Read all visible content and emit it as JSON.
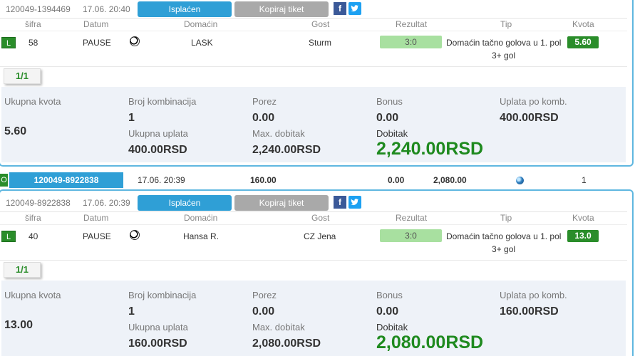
{
  "tickets": [
    {
      "code": "120049-1394469",
      "time": "17.06. 20:40",
      "paid_label": "Isplaćen",
      "copy_label": "Kopiraj tiket",
      "fb_label": "f",
      "columns": {
        "sifra": "šifra",
        "datum": "Datum",
        "domacin": "Domaćin",
        "gost": "Gost",
        "rezultat": "Rezultat",
        "tip": "Tip",
        "kvota": "Kvota"
      },
      "row": {
        "status": "L",
        "sifra": "58",
        "datum": "PAUSE",
        "domacin": "LASK",
        "gost": "Sturm",
        "rezultat": "3:0",
        "tip_line1": "Domaćin tačno golova u 1. pol",
        "tip_line2": "3+ gol",
        "kvota": "5.60"
      },
      "counter": "1/1",
      "summary": {
        "ukupna_kvota_label": "Ukupna kvota",
        "ukupna_kvota": "5.60",
        "broj_komb_label": "Broj kombinacija",
        "broj_komb": "1",
        "ukupna_uplata_label": "Ukupna uplata",
        "ukupna_uplata": "400.00RSD",
        "porez_label": "Porez",
        "porez": "0.00",
        "max_dobitak_label": "Max. dobitak",
        "max_dobitak": "2,240.00RSD",
        "bonus_label": "Bonus",
        "bonus": "0.00",
        "dobitak_label": "Dobitak",
        "dobitak": "2,240.00RSD",
        "uplata_po_komb_label": "Uplata po komb.",
        "uplata_po_komb": "400.00RSD"
      }
    },
    {
      "code": "120049-8922838",
      "time": "17.06. 20:39",
      "paid_label": "Isplaćen",
      "copy_label": "Kopiraj tiket",
      "fb_label": "f",
      "columns": {
        "sifra": "šifra",
        "datum": "Datum",
        "domacin": "Domaćin",
        "gost": "Gost",
        "rezultat": "Rezultat",
        "tip": "Tip",
        "kvota": "Kvota"
      },
      "row": {
        "status": "L",
        "sifra": "40",
        "datum": "PAUSE",
        "domacin": "Hansa R.",
        "gost": "CZ Jena",
        "rezultat": "3:0",
        "tip_line1": "Domaćin tačno golova u 1. pol",
        "tip_line2": "3+ gol",
        "kvota": "13.0"
      },
      "counter": "1/1",
      "summary": {
        "ukupna_kvota_label": "Ukupna kvota",
        "ukupna_kvota": "13.00",
        "broj_komb_label": "Broj kombinacija",
        "broj_komb": "1",
        "ukupna_uplata_label": "Ukupna uplata",
        "ukupna_uplata": "160.00RSD",
        "porez_label": "Porez",
        "porez": "0.00",
        "max_dobitak_label": "Max. dobitak",
        "max_dobitak": "2,080.00RSD",
        "bonus_label": "Bonus",
        "bonus": "0.00",
        "dobitak_label": "Dobitak",
        "dobitak": "2,080.00RSD",
        "uplata_po_komb_label": "Uplata po komb.",
        "uplata_po_komb": "160.00RSD"
      }
    }
  ],
  "list_row": {
    "status": "O",
    "code": "120049-8922838",
    "time": "17.06. 20:39",
    "stake": "160.00",
    "tax": "0.00",
    "win": "2,080.00",
    "count": "1"
  },
  "colors": {
    "accent_blue": "#2f9fd6",
    "win_green": "#1f8a1f",
    "badge_green": "#2a8d2a",
    "summary_bg": "#eef2f8",
    "frame_blue": "#5fb7e0"
  }
}
